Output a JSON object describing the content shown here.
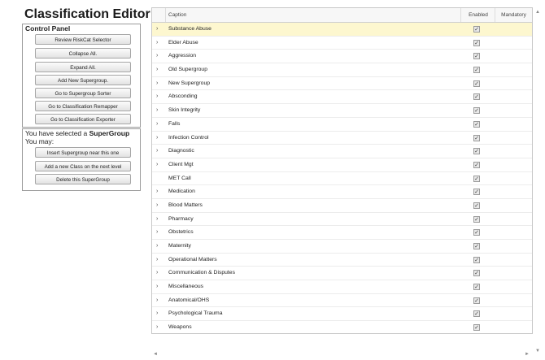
{
  "title": "Classification Editor",
  "control_panel": {
    "title": "Control Panel",
    "buttons": [
      "Review RiskCat Selector",
      "Collapse All.",
      "Expand All.",
      "Add New Supergroup.",
      "Go to Supergroup Sorter",
      "Go to Classification Remapper",
      "Go to Classification Exporter"
    ]
  },
  "supergroup_panel": {
    "prefix": "You have selected a ",
    "bold": "SuperGroup",
    "line2": "You may:",
    "buttons": [
      "Insert Supergroup near this one",
      "Add a new Class on the next level",
      "Delete this SuperGroup"
    ]
  },
  "grid": {
    "columns": {
      "caption": "Caption",
      "enabled": "Enabled",
      "mandatory": "Mandatory"
    },
    "check_glyph": "✓",
    "expand_glyph": "›",
    "rows": [
      {
        "caption": "Substance Abuse",
        "expandable": true,
        "enabled": true,
        "selected": true
      },
      {
        "caption": "Elder Abuse",
        "expandable": true,
        "enabled": true
      },
      {
        "caption": "Aggression",
        "expandable": true,
        "enabled": true
      },
      {
        "caption": "Old Supergroup",
        "expandable": true,
        "enabled": true
      },
      {
        "caption": "New Supergroup",
        "expandable": true,
        "enabled": true
      },
      {
        "caption": "Absconding",
        "expandable": true,
        "enabled": true
      },
      {
        "caption": "Skin Integrity",
        "expandable": true,
        "enabled": true
      },
      {
        "caption": "Falls",
        "expandable": true,
        "enabled": true
      },
      {
        "caption": "Infection Control",
        "expandable": true,
        "enabled": true
      },
      {
        "caption": "Diagnostic",
        "expandable": true,
        "enabled": true
      },
      {
        "caption": "Client Mgt",
        "expandable": true,
        "enabled": true
      },
      {
        "caption": "MET Call",
        "expandable": false,
        "enabled": true
      },
      {
        "caption": "Medication",
        "expandable": true,
        "enabled": true
      },
      {
        "caption": "Blood Matters",
        "expandable": true,
        "enabled": true
      },
      {
        "caption": "Pharmacy",
        "expandable": true,
        "enabled": true
      },
      {
        "caption": "Obstetrics",
        "expandable": true,
        "enabled": true
      },
      {
        "caption": "Maternity",
        "expandable": true,
        "enabled": true
      },
      {
        "caption": "Operational Matters",
        "expandable": true,
        "enabled": true
      },
      {
        "caption": "Communication & Disputes",
        "expandable": true,
        "enabled": true
      },
      {
        "caption": "Miscellaneous",
        "expandable": true,
        "enabled": true
      },
      {
        "caption": "Anatomical/OHS",
        "expandable": true,
        "enabled": true
      },
      {
        "caption": "Psychological Trauma",
        "expandable": true,
        "enabled": true
      },
      {
        "caption": "Weapons",
        "expandable": true,
        "enabled": true
      }
    ]
  },
  "icons": {
    "scroll_up": "chevron-up-icon",
    "scroll_down": "chevron-down-icon",
    "scroll_left": "chevron-left-icon",
    "scroll_right": "chevron-right-icon"
  }
}
